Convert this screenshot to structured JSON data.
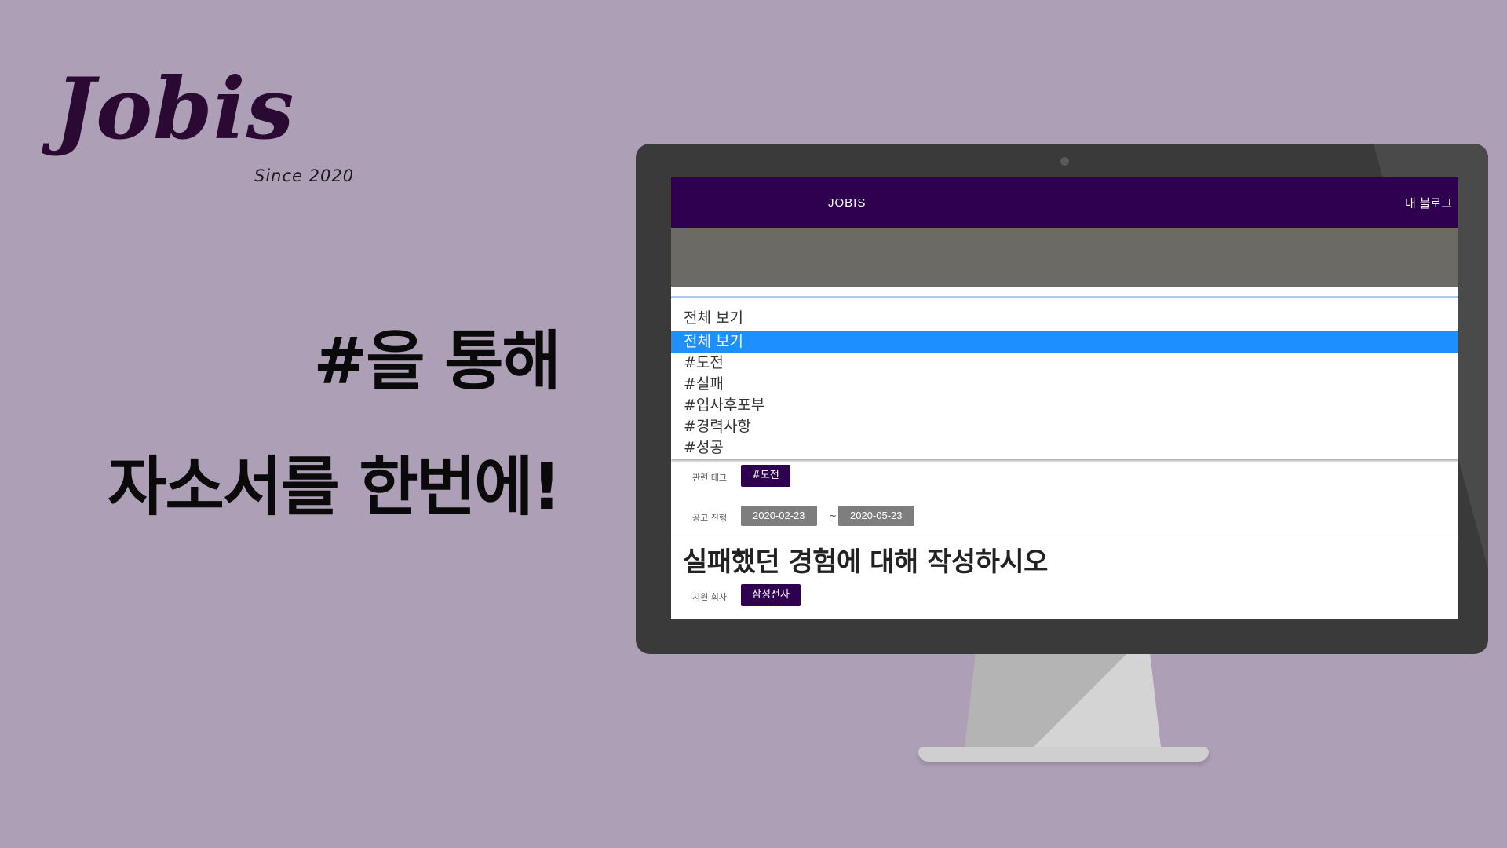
{
  "brand": {
    "name": "Jobis",
    "since": "Since 2020"
  },
  "headline": {
    "line1": "#을 통해",
    "line2": "자소서를 한번에!"
  },
  "app": {
    "nav": {
      "logo": "JOBIS",
      "blog_link": "내 블로그"
    },
    "filter": {
      "selected": "전체 보기",
      "options": [
        "전체 보기",
        "#도전",
        "#실패",
        "#입사후포부",
        "#경력사항",
        "#성공"
      ]
    },
    "post": {
      "tag_label": "관련 태그",
      "tag": "#도전",
      "period_label": "공고 진행",
      "start_date": "2020-02-23",
      "range_separator": "~",
      "end_date": "2020-05-23",
      "question": "실패했던 경험에 대해 작성하시오",
      "company_label": "지원 회사",
      "company": "삼성전자"
    }
  },
  "colors": {
    "background": "#ad9fb5",
    "brand_dark": "#2a0a33",
    "nav_purple": "#2f0050",
    "select_highlight": "#1e8fff",
    "date_chip": "#7e7e7e"
  }
}
